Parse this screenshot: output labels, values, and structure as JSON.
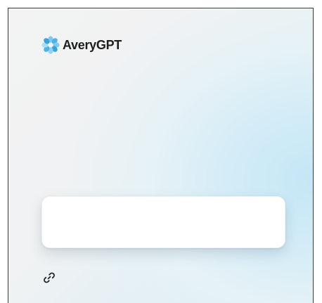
{
  "brand": {
    "name": "AveryGPT",
    "logo_icon": "petal-ring-logo-icon",
    "logo_color": "#5bb8e6"
  },
  "composer": {
    "value": "",
    "placeholder": ""
  },
  "toolbar": {
    "link_icon": "link-icon"
  },
  "colors": {
    "background_start": "#f3f3f3",
    "background_end": "#c4e6f6",
    "text": "#1e1e1e"
  }
}
